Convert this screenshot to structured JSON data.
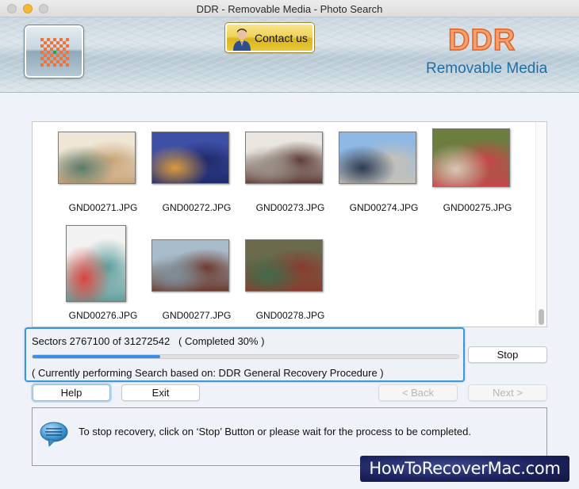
{
  "window": {
    "title": "DDR - Removable Media - Photo Search"
  },
  "banner": {
    "contact_label": "Contact us",
    "brand_name": "DDR",
    "brand_subtitle": "Removable Media",
    "logo_icon": "ddr-pixel-star-icon",
    "contact_icon": "person-icon"
  },
  "thumbnails": [
    {
      "name": "GND00271.JPG",
      "palette": [
        "#efe6d6",
        "#c9a478",
        "#5b7a69"
      ],
      "orientation": "landscape"
    },
    {
      "name": "GND00272.JPG",
      "palette": [
        "#3e4fa6",
        "#1f2a6b",
        "#d99a3a"
      ],
      "orientation": "landscape"
    },
    {
      "name": "GND00273.JPG",
      "palette": [
        "#e9e6e1",
        "#5b3b34",
        "#9a8f86"
      ],
      "orientation": "landscape"
    },
    {
      "name": "GND00274.JPG",
      "palette": [
        "#8fb8e4",
        "#c9c2b6",
        "#2e3a4f"
      ],
      "orientation": "landscape"
    },
    {
      "name": "GND00275.JPG",
      "palette": [
        "#6d7d3f",
        "#c9444a",
        "#d8c7b3"
      ],
      "orientation": "landscape"
    },
    {
      "name": "GND00276.JPG",
      "palette": [
        "#f2f2f2",
        "#5f9e9c",
        "#d8453e"
      ],
      "orientation": "portrait"
    },
    {
      "name": "GND00277.JPG",
      "palette": [
        "#a9bccb",
        "#6b3a2e",
        "#7d8e98"
      ],
      "orientation": "landscape"
    },
    {
      "name": "GND00278.JPG",
      "palette": [
        "#6b6a4c",
        "#8a3a2e",
        "#3f6b4a"
      ],
      "orientation": "landscape"
    }
  ],
  "progress": {
    "sectors_text": "Sectors 2767100 of 31272542   ( Completed 30% )",
    "sectors_done": 2767100,
    "sectors_total": 31272542,
    "percent_complete": 30,
    "current_text": "( Currently performing Search based on: DDR General Recovery Procedure )"
  },
  "buttons": {
    "stop": "Stop",
    "help": "Help",
    "exit": "Exit",
    "back": "< Back",
    "next": "Next >"
  },
  "message": {
    "icon": "speech-bubble-icon",
    "text": "To stop recovery, click on ‘Stop’ Button or please wait for the process to be completed."
  },
  "watermark": "HowToRecoverMac.com",
  "colors": {
    "accent": "#3d97d8",
    "progress_fill": "#3b8ee3",
    "brand_orange": "#f6a06b",
    "brand_blue": "#1f6fa8",
    "contact_gold": "#f0d35a"
  }
}
